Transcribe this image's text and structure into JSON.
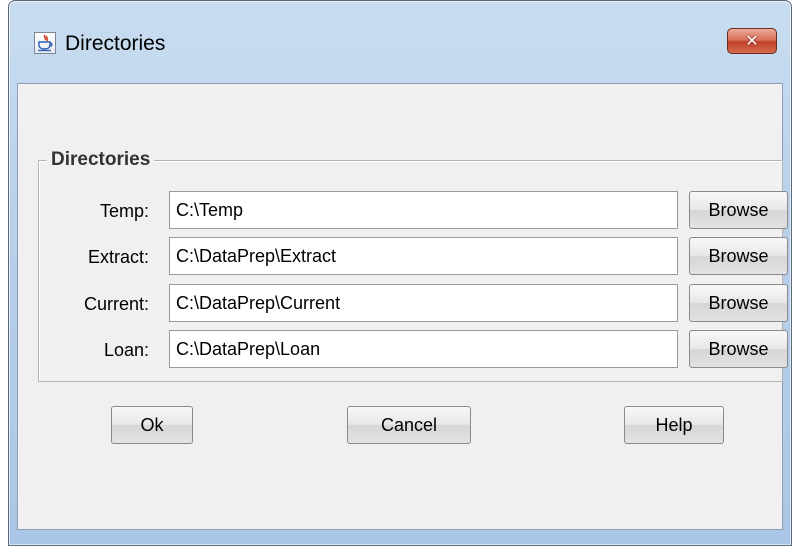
{
  "window": {
    "title": "Directories",
    "icon": "java-cup-icon",
    "close_label": "✕"
  },
  "group": {
    "title": "Directories",
    "rows": [
      {
        "label": "Temp:",
        "value": "C:\\Temp",
        "browse_label": "Browse"
      },
      {
        "label": "Extract:",
        "value": "C:\\DataPrep\\Extract",
        "browse_label": "Browse"
      },
      {
        "label": "Current:",
        "value": "C:\\DataPrep\\Current",
        "browse_label": "Browse"
      },
      {
        "label": "Loan:",
        "value": "C:\\DataPrep\\Loan",
        "browse_label": "Browse"
      }
    ]
  },
  "actions": {
    "ok_label": "Ok",
    "cancel_label": "Cancel",
    "help_label": "Help"
  },
  "colors": {
    "title_bar": "#b9d0ea",
    "close_button": "#c1432c",
    "client_background": "#f0f0f0"
  }
}
